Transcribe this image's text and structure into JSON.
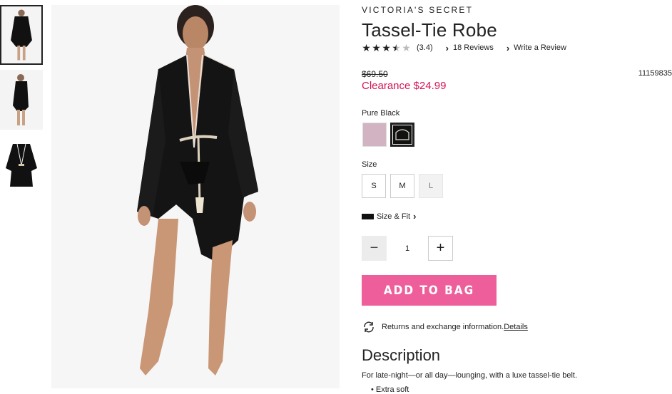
{
  "product": {
    "brand": "VICTORIA'S SECRET",
    "title": "Tassel-Tie Robe",
    "rating_value": 3.4,
    "rating_text": "(3.4)",
    "reviews_link": "18 Reviews",
    "write_review_link": "Write a Review",
    "original_price": "$69.50",
    "sale_price": "Clearance $24.99",
    "sku": "11159835",
    "color_label": "Pure Black",
    "size_label": "Size",
    "sizes": [
      "S",
      "M",
      "L"
    ],
    "size_fit_link": "Size & Fit",
    "quantity": "1",
    "add_to_bag": "ADD TO BAG",
    "returns_text": "Returns and exchange information.",
    "returns_details_link": "Details",
    "description_heading": "Description",
    "description_text": "For late-night—or all day—lounging, with a luxe tassel-tie belt.",
    "description_cut": "• Extra soft"
  },
  "colors": {
    "sale": "#d4145a",
    "add_to_bag_bg": "#ee5e9b",
    "swatch_pink": "#d1b3c1",
    "swatch_black": "#111111"
  },
  "icons": [
    "star-icon",
    "chevron-right-icon",
    "ruler-icon",
    "minus-icon",
    "plus-icon",
    "returns-icon"
  ]
}
